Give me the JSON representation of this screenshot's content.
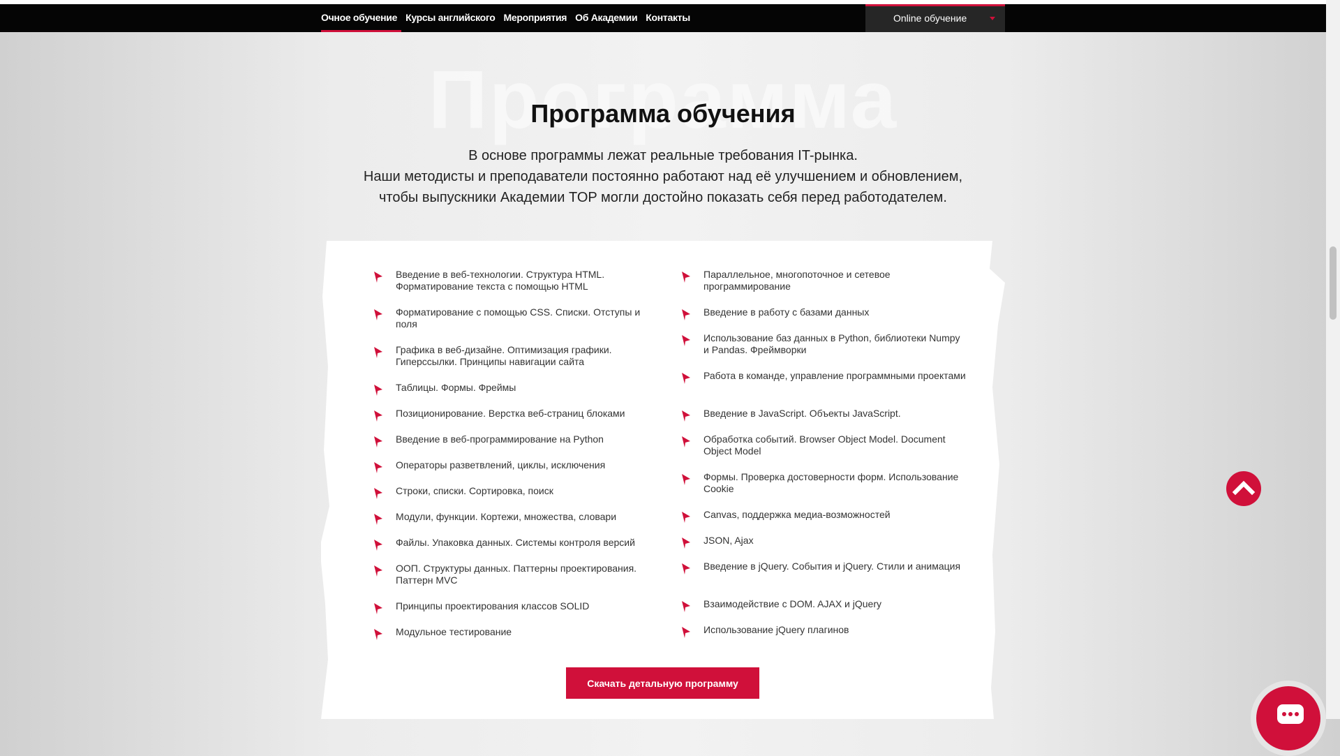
{
  "nav": {
    "items": [
      {
        "label": "Очное обучение",
        "active": true
      },
      {
        "label": "Курсы английского",
        "active": false
      },
      {
        "label": "Мероприятия",
        "active": false
      },
      {
        "label": "Об Академии",
        "active": false
      },
      {
        "label": "Контакты",
        "active": false
      }
    ],
    "online_label": "Online обучение"
  },
  "section": {
    "watermark": "Программа",
    "title": "Программа обучения",
    "description": [
      "В основе программы лежат реальные требования IT-рынка.",
      "Наши методисты и преподаватели постоянно работают над её улучшением и обновлением,",
      "чтобы выпускники Академии TOP могли достойно показать себя перед работодателем."
    ]
  },
  "program": {
    "left": [
      "Введение в веб-технологии. Структура HTML. Форматирование текста с помощью HTML",
      "Форматирование с помощью CSS. Списки. Отступы и поля",
      "Графика в веб-дизайне. Оптимизация графики. Гиперссылки. Принципы навигации сайта",
      "Таблицы. Формы. Фреймы",
      "Позиционирование. Верстка веб-страниц блоками",
      "Введение в веб-программирование на Python",
      "Операторы разветвлений, циклы, исключения",
      "Строки, списки. Сортировка, поиск",
      "Модули, функции. Кортежи, множества, словари",
      "Файлы. Упаковка данных. Системы контроля версий",
      "ООП. Структуры данных. Паттерны проектирования. Паттерн MVC",
      "Принципы проектирования классов SOLID",
      "Модульное тестирование"
    ],
    "right": [
      "Параллельное, многопоточное и сетевое программирование",
      "Введение в работу с базами данных",
      "Использование баз данных в Python, библиотеки Numpy и Pandas. Фреймворки",
      "Работа в команде, управление программными проектами",
      "Введение в JavaScript. Объекты JavaScript.",
      "Обработка событий. Browser Object Model. Document Object Model",
      "Формы. Проверка достоверности форм. Использование Cookie",
      "Canvas, поддержка медиа-возможностей",
      "JSON, Ajax",
      "Введение в jQuery. События и jQuery. Стили и анимация",
      "Взаимодействие с DOM. AJAX и jQuery",
      "Использование jQuery плагинов"
    ],
    "download_label": "Скачать детальную программу"
  },
  "colors": {
    "accent": "#d0103a",
    "nav_bg": "#050505",
    "online_bg": "#262626"
  },
  "icons": {
    "bullet": "red-arrow-bullet-icon",
    "scroll_top": "chevron-up-icon",
    "chat": "chat-bubble-icon"
  }
}
